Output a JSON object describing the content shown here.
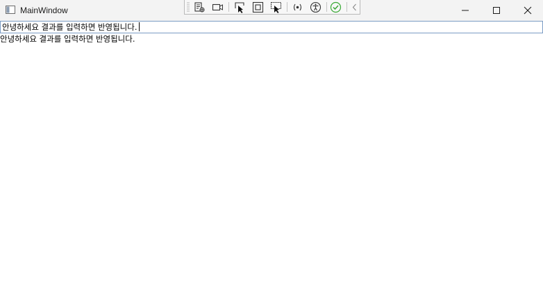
{
  "window": {
    "title": "MainWindow"
  },
  "dev_toolbar": {
    "buttons": [
      {
        "icon": "live-visual-tree-icon"
      },
      {
        "icon": "video-camera-icon"
      },
      {
        "icon": "select-element-icon"
      },
      {
        "icon": "display-layout-adorners-icon"
      },
      {
        "icon": "track-focused-element-icon"
      },
      {
        "icon": "binding-failures-icon"
      },
      {
        "icon": "accessibility-icon"
      },
      {
        "icon": "checkmark-circle-icon"
      },
      {
        "icon": "collapse-chevron-icon"
      }
    ]
  },
  "caption_buttons": {
    "minimize": "minimize-icon",
    "maximize": "maximize-icon",
    "close": "close-icon"
  },
  "content": {
    "input_value": "안녕하세요 결과를 입력하면 반영됩니다.",
    "result_text": "안녕하세요 결과를 입력하면 반영됩니다."
  },
  "colors": {
    "titlebar_bg": "#f3f3f3",
    "textbox_border": "#7a9cc4",
    "check_green": "#3aa935"
  }
}
